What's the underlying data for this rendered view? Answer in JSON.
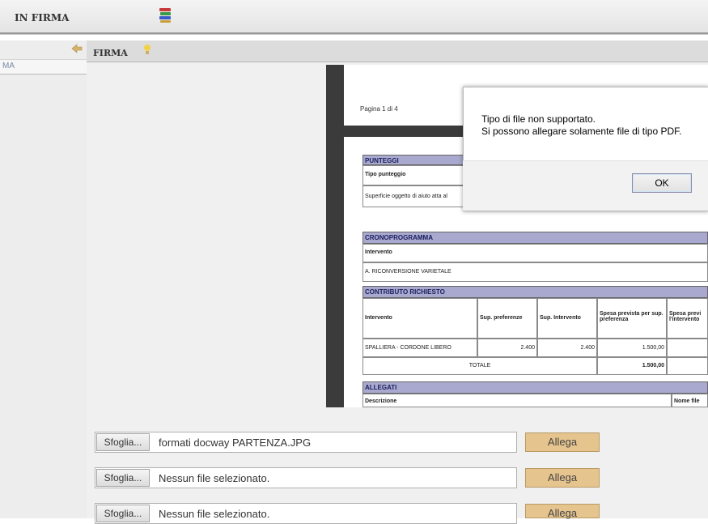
{
  "topbar": {
    "title": "IN FIRMA",
    "icon": "books-icon"
  },
  "secondbar": {
    "title": "FIRMA",
    "left_icon": "arrow-icon",
    "right_icon": "lightbulb-icon"
  },
  "leftpanel": {
    "tab_label": "MA"
  },
  "document": {
    "page_label": "Pagina 1 di  4",
    "punteggi": {
      "header": "PUNTEGGI",
      "col": "Tipo punteggio",
      "row": "Superficie oggetto di aiuto atta al"
    },
    "cronoprogramma": {
      "header": "CRONOPROGRAMMA",
      "col": "Intervento",
      "row": "A. RICONVERSIONE VARIETALE"
    },
    "contributo": {
      "header": "CONTRIBUTO RICHIESTO",
      "columns": [
        "Intervento",
        "Sup. preferenze",
        "Sup. Intervento",
        "Spesa prevista per sup. preferenza",
        "Spesa previ l'intervento"
      ],
      "row": [
        "SPALLIERA - CORDONE LIBERO",
        "2.400",
        "2.400",
        "1.500,00"
      ],
      "total_label": "TOTALE",
      "total_value": "1.500,00"
    },
    "allegati": {
      "header": "ALLEGATI",
      "col1": "Descrizione",
      "col2": "Nome file"
    }
  },
  "dialog": {
    "line1": "Tipo di file non supportato.",
    "line2": "Si possono allegare solamente file di tipo PDF.",
    "ok_label": "OK"
  },
  "uploads": [
    {
      "browse_label": "Sfoglia...",
      "file": "formati docway PARTENZA.JPG",
      "attach_label": "Allega"
    },
    {
      "browse_label": "Sfoglia...",
      "file": "Nessun file selezionato.",
      "attach_label": "Allega"
    },
    {
      "browse_label": "Sfoglia...",
      "file": "Nessun file selezionato.",
      "attach_label": "Allega"
    }
  ],
  "colors": {
    "section_header": "#a9a9cf",
    "allega_button": "#e6c48e",
    "doc_bar": "#3b3b3b"
  }
}
